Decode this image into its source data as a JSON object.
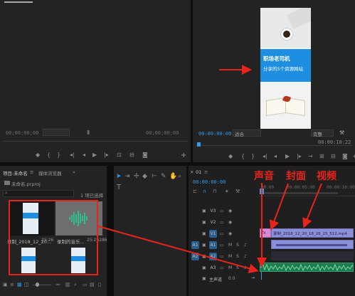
{
  "source_monitor": {
    "timecode_left": "00;00;00;00",
    "timecode_right": "00;00;00;00"
  },
  "program_monitor": {
    "timecode": "00:00:00:00",
    "fit_label": "适合",
    "quality_label": "完整",
    "timecode_right": "00:00:10:22",
    "preview": {
      "headline": "职场老司机",
      "subline": "分享的5个资源网站"
    }
  },
  "project_panel": {
    "tab_project": "项目:未命名",
    "tab_media_browser": "媒体浏览器",
    "menu_icon": "≡",
    "tab_more": "»",
    "file_name": "未命名.prproj",
    "items_count": "1 项已选择",
    "thumbs": [
      {
        "name": "录制_2018_12_20...",
        "duration": "25:26"
      },
      {
        "name": "录制的音乐...",
        "duration": "25:26286"
      }
    ]
  },
  "timeline": {
    "tab_label": "01",
    "timecode": "00:00:00:00",
    "ruler": [
      "00:00",
      "00:00:05:00",
      "00:00:10:00"
    ],
    "tracks": [
      {
        "id": "V3",
        "selected": false
      },
      {
        "id": "V2",
        "selected": false
      },
      {
        "id": "V1",
        "selected": true
      },
      {
        "id": "A1",
        "selected": true
      },
      {
        "id": "A2",
        "selected": true
      },
      {
        "id": "A3",
        "selected": false
      }
    ],
    "source_patches": [
      "A1",
      "A2"
    ],
    "master_label": "主声道",
    "master_value": "0.0",
    "clips": {
      "cover": "fx",
      "video": "录制_2018_12_20_18_26_25_512.mp4"
    }
  },
  "annotations": {
    "sound": "声音",
    "cover": "封面",
    "video": "视频"
  },
  "colors": {
    "accent_blue": "#2f9cf0",
    "annotation_red": "#e8231b",
    "video_clip": "#8b8fd8",
    "cover_clip": "#d78ad8",
    "audio_clip": "#1f7a4e"
  }
}
